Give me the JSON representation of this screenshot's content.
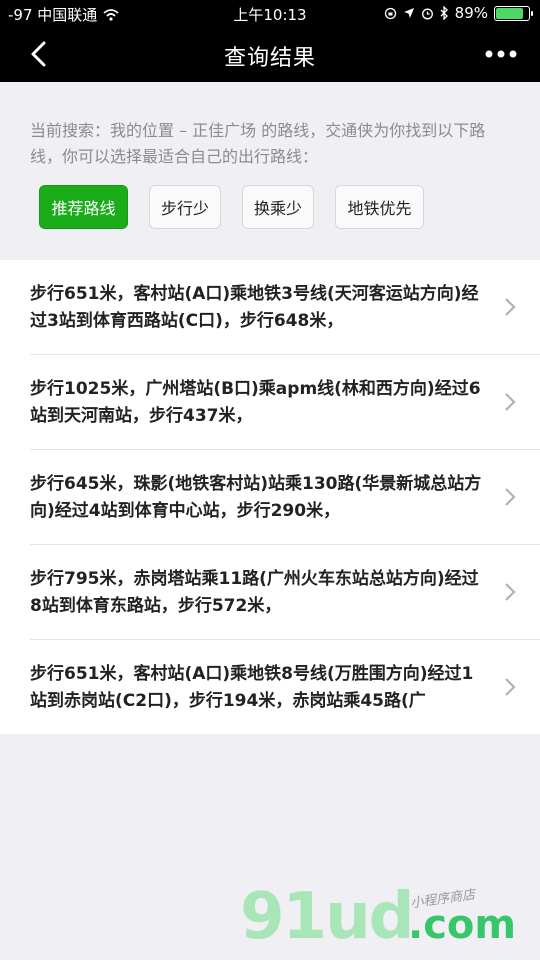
{
  "status": {
    "carrier": "-97 中国联通",
    "time": "上午10:13",
    "battery": "89%",
    "battery_level": 0.89
  },
  "nav": {
    "title": "查询结果"
  },
  "search": {
    "description": "当前搜索：我的位置 – 正佳广场 的路线，交通侠为你找到以下路线，你可以选择最适合自己的出行路线：",
    "filters": [
      "推荐路线",
      "步行少",
      "换乘少",
      "地铁优先"
    ],
    "active_filter": 0
  },
  "routes": [
    "步行651米，客村站(A口)乘地铁3号线(天河客运站方向)经过3站到体育西路站(C口)，步行648米，",
    "步行1025米，广州塔站(B口)乘apm线(林和西方向)经过6站到天河南站，步行437米，",
    "步行645米，珠影(地铁客村站)站乘130路(华景新城总站方向)经过4站到体育中心站，步行290米，",
    "步行795米，赤岗塔站乘11路(广州火车东站总站方向)经过8站到体育东路站，步行572米，",
    "步行651米，客村站(A口)乘地铁8号线(万胜围方向)经过1站到赤岗站(C2口)，步行194米，赤岗站乘45路(广"
  ],
  "watermark": {
    "brand": "91ud",
    "domain": ".com",
    "tagline": "小程序商店"
  },
  "colors": {
    "accent": "#1aad19",
    "navbar": "#000000"
  },
  "icons": {
    "back": "chevron-left-icon",
    "more": "more-dots-icon",
    "wifi": "wifi-icon",
    "chevron": "chevron-right-icon"
  }
}
